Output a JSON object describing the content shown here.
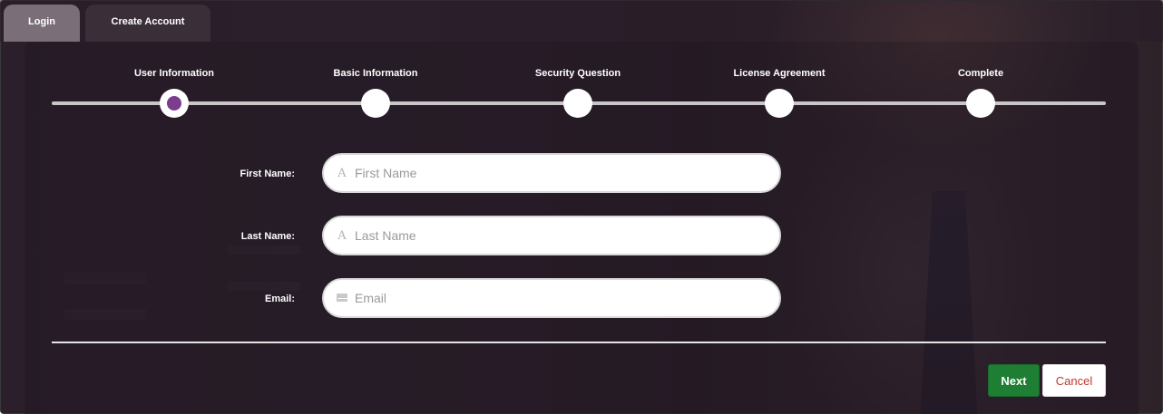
{
  "tabs": [
    {
      "label": "Login"
    },
    {
      "label": "Create Account"
    }
  ],
  "wizard": {
    "steps": [
      {
        "label": "User Information",
        "active": true
      },
      {
        "label": "Basic Information",
        "active": false
      },
      {
        "label": "Security Question",
        "active": false
      },
      {
        "label": "License Agreement",
        "active": false
      },
      {
        "label": "Complete",
        "active": false
      }
    ],
    "accent_color": "#7b3d8c"
  },
  "form": {
    "first_name": {
      "label": "First Name:",
      "placeholder": "First Name",
      "value": "",
      "icon": "font-icon"
    },
    "last_name": {
      "label": "Last Name:",
      "placeholder": "Last Name",
      "value": "",
      "icon": "font-icon"
    },
    "email": {
      "label": "Email:",
      "placeholder": "Email",
      "value": "",
      "icon": "envelope-icon"
    }
  },
  "buttons": {
    "next_label": "Next",
    "cancel_label": "Cancel",
    "next_color": "#1e7e34",
    "cancel_color": "#c0392b"
  }
}
